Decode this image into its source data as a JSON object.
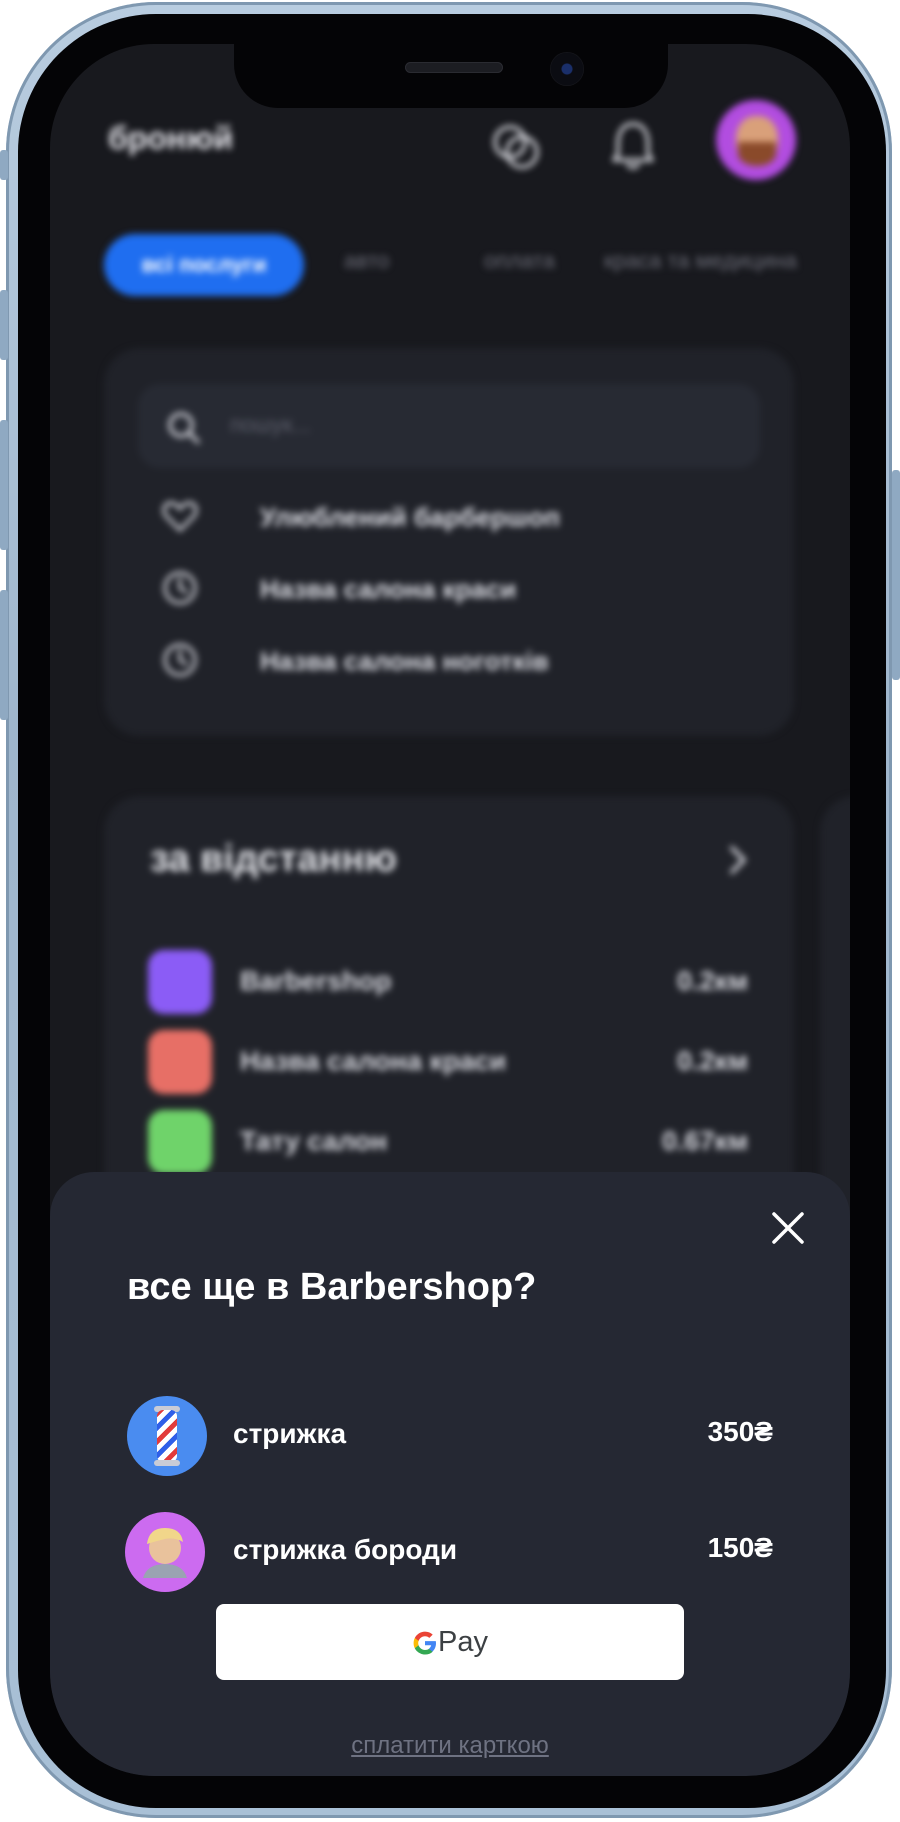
{
  "app": {
    "title": "бронюй"
  },
  "tabs": [
    {
      "label": "всі послуги",
      "active": true
    },
    {
      "label": "авто",
      "active": false
    },
    {
      "label": "оплата",
      "active": false
    },
    {
      "label": "краса та медицина",
      "active": false
    }
  ],
  "search": {
    "placeholder": "пошук...",
    "recent": [
      {
        "icon": "heart-icon",
        "label": "Улюблений барбершоп"
      },
      {
        "icon": "clock-icon",
        "label": "Назва салона краси"
      },
      {
        "icon": "clock-icon",
        "label": "Назва салона ноготків"
      }
    ]
  },
  "distance": {
    "title": "за відстанню",
    "places": [
      {
        "name": "Barbershop",
        "distance": "0.2км",
        "color": "#8b5cf6"
      },
      {
        "name": "Назва салона краси",
        "distance": "0.2км",
        "color": "#e76f66"
      },
      {
        "name": "Тату салон",
        "distance": "0.67км",
        "color": "#6fd36a"
      },
      {
        "name": "",
        "distance": "",
        "color": "#f2c94c"
      }
    ]
  },
  "sheet": {
    "title": "все ще в Barbershop?",
    "services": [
      {
        "name": "стрижка",
        "price": "350₴",
        "icon": "barber-pole-icon",
        "color": "#4a8cf0"
      },
      {
        "name": "стрижка бороди",
        "price": "150₴",
        "icon": "haircut-person-icon",
        "color": "#cc6bf0"
      }
    ],
    "gpay_label": "Pay",
    "card_link": "сплатити карткою"
  },
  "colors": {
    "accent": "#1f6ef0",
    "sheet_bg": "#252833",
    "screen_bg": "#18191e"
  }
}
